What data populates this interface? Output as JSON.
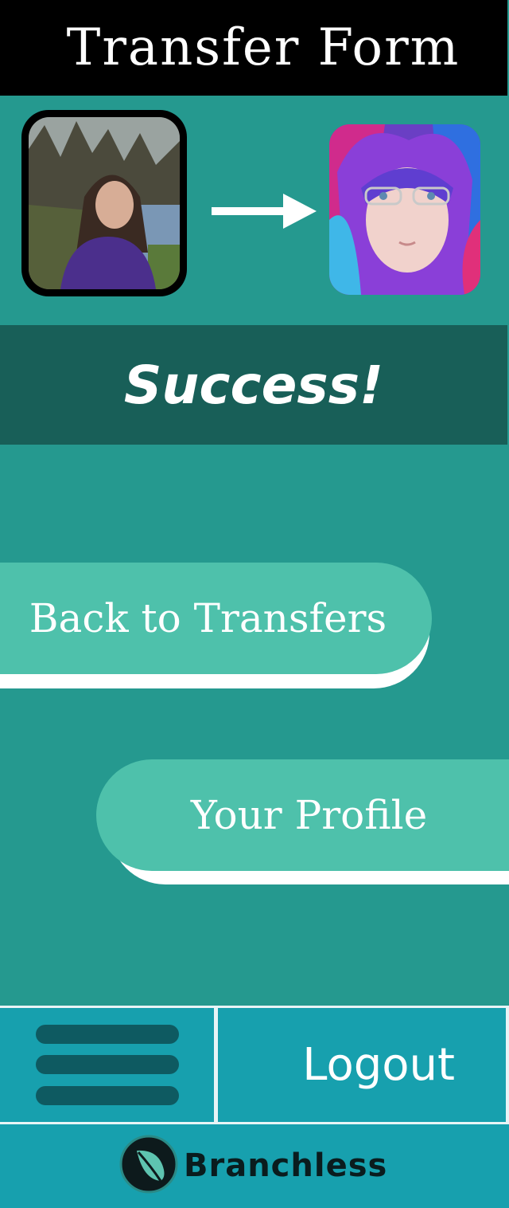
{
  "header": {
    "title": "Transfer Form"
  },
  "transfer": {
    "from_avatar_icon": "avatar-from",
    "to_avatar_icon": "avatar-to",
    "arrow_icon": "arrow-right-icon",
    "status": "Success!"
  },
  "actions": {
    "back_label": "Back to Transfers",
    "profile_label": "Your Profile"
  },
  "nav": {
    "menu_icon": "hamburger-menu-icon",
    "logout_label": "Logout"
  },
  "footer": {
    "brand_name": "Branchless",
    "logo_icon": "leaf-icon"
  },
  "colors": {
    "background": "#25998f",
    "header": "#000000",
    "success_bar": "#185f58",
    "button": "#4ec1ab",
    "nav": "#17a0ae",
    "menu_lines": "#0e5a61"
  }
}
